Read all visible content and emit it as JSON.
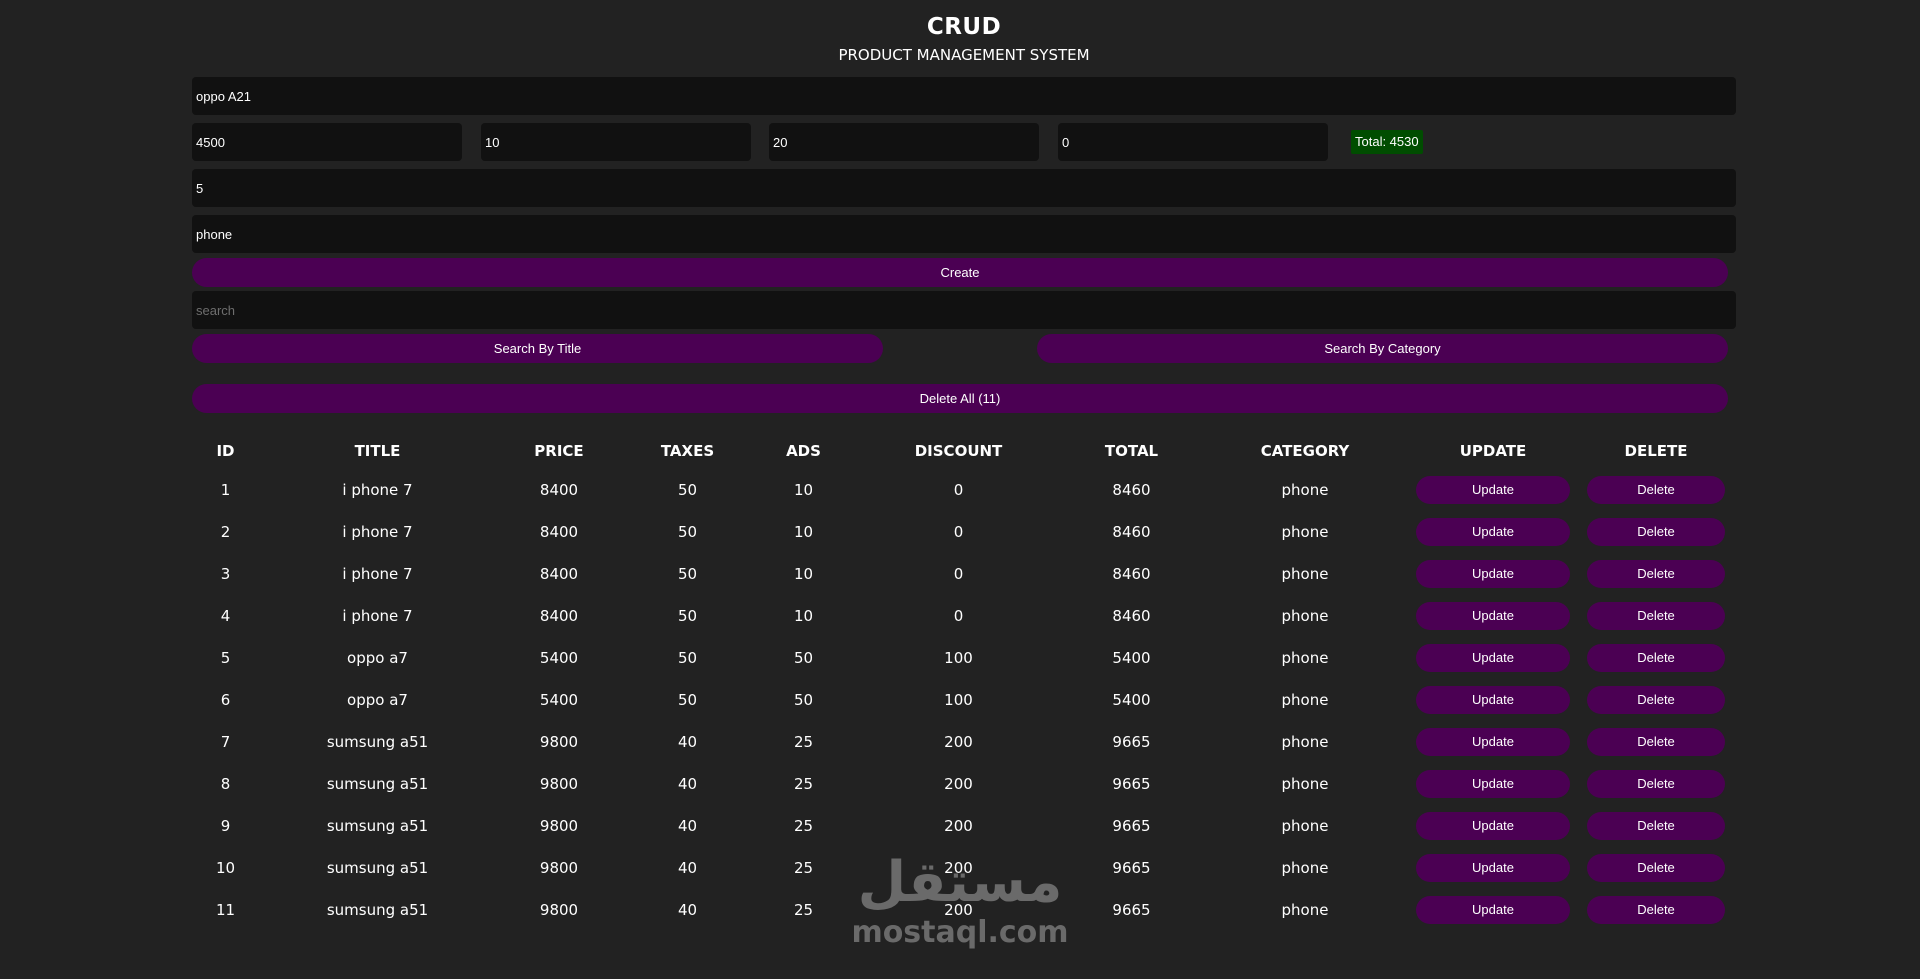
{
  "header": {
    "title": "CRUD",
    "subtitle": "PRODUCT MANAGEMENT SYSTEM"
  },
  "form": {
    "title_value": "oppo A21",
    "price_value": "4500",
    "taxes_value": "10",
    "ads_value": "20",
    "discount_value": "0",
    "total_label": "Total: 4530",
    "count_value": "5",
    "category_value": "phone",
    "create_label": "Create",
    "search_placeholder": "search",
    "search_title_label": "Search By Title",
    "search_category_label": "Search By Category",
    "delete_all_label": "Delete All (11)"
  },
  "colors": {
    "background": "#222222",
    "input_bg": "#111111",
    "button_bg": "#4b0053",
    "total_bg": "#004d00"
  },
  "table": {
    "headers": [
      "ID",
      "TITLE",
      "PRICE",
      "TAXES",
      "ADS",
      "DISCOUNT",
      "TOTAL",
      "CATEGORY",
      "UPDATE",
      "DELETE"
    ],
    "update_label": "Update",
    "delete_label": "Delete",
    "rows": [
      [
        "1",
        "i phone 7",
        "8400",
        "50",
        "10",
        "0",
        "8460",
        "phone"
      ],
      [
        "2",
        "i phone 7",
        "8400",
        "50",
        "10",
        "0",
        "8460",
        "phone"
      ],
      [
        "3",
        "i phone 7",
        "8400",
        "50",
        "10",
        "0",
        "8460",
        "phone"
      ],
      [
        "4",
        "i phone 7",
        "8400",
        "50",
        "10",
        "0",
        "8460",
        "phone"
      ],
      [
        "5",
        "oppo a7",
        "5400",
        "50",
        "50",
        "100",
        "5400",
        "phone"
      ],
      [
        "6",
        "oppo a7",
        "5400",
        "50",
        "50",
        "100",
        "5400",
        "phone"
      ],
      [
        "7",
        "sumsung a51",
        "9800",
        "40",
        "25",
        "200",
        "9665",
        "phone"
      ],
      [
        "8",
        "sumsung a51",
        "9800",
        "40",
        "25",
        "200",
        "9665",
        "phone"
      ],
      [
        "9",
        "sumsung a51",
        "9800",
        "40",
        "25",
        "200",
        "9665",
        "phone"
      ],
      [
        "10",
        "sumsung a51",
        "9800",
        "40",
        "25",
        "200",
        "9665",
        "phone"
      ],
      [
        "11",
        "sumsung a51",
        "9800",
        "40",
        "25",
        "200",
        "9665",
        "phone"
      ]
    ]
  },
  "watermark": {
    "arabic": "مستقل",
    "latin": "mostaql.com"
  }
}
